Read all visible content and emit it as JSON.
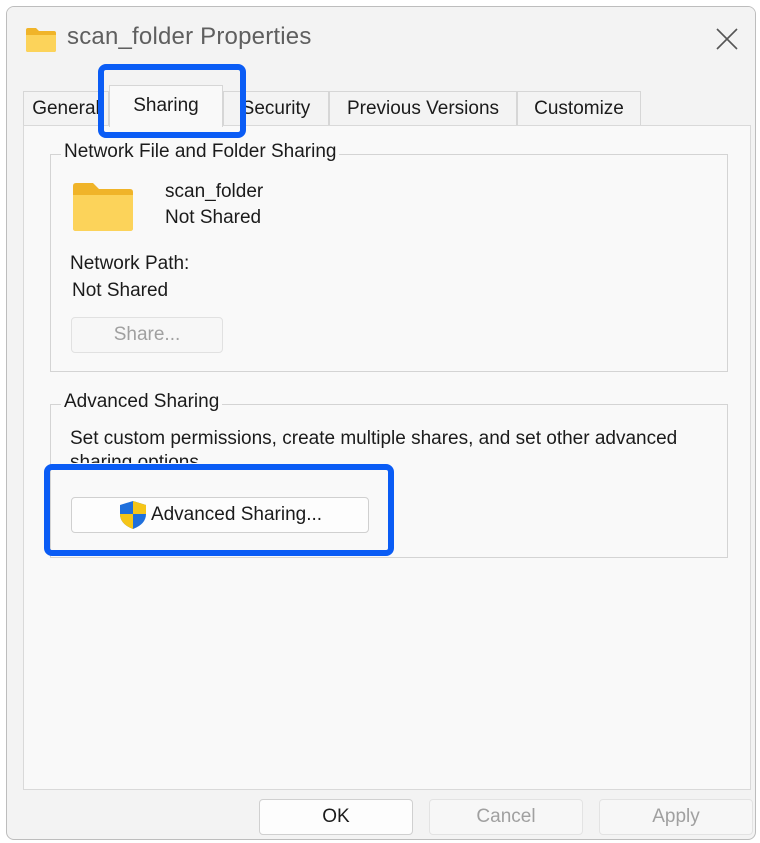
{
  "window": {
    "title": "scan_folder Properties"
  },
  "tabs": [
    {
      "label": "General"
    },
    {
      "label": "Sharing"
    },
    {
      "label": "Security"
    },
    {
      "label": "Previous Versions"
    },
    {
      "label": "Customize"
    }
  ],
  "active_tab": "Sharing",
  "network_sharing": {
    "legend": "Network File and Folder Sharing",
    "folder_name": "scan_folder",
    "folder_status": "Not Shared",
    "path_label": "Network Path:",
    "path_value": "Not Shared",
    "share_button": "Share..."
  },
  "advanced_sharing": {
    "legend": "Advanced Sharing",
    "description": "Set custom permissions, create multiple shares, and set other advanced sharing options.",
    "button": "Advanced Sharing..."
  },
  "footer": {
    "ok": "OK",
    "cancel": "Cancel",
    "apply": "Apply"
  },
  "icons": {
    "title": "folder-icon",
    "close": "close-icon",
    "folder": "folder-icon",
    "shield": "uac-shield-icon"
  },
  "colors": {
    "highlight": "#0a5cf5",
    "folder": "#f8c93c",
    "shield_blue": "#1f6fdc",
    "shield_yellow": "#f5c518"
  }
}
